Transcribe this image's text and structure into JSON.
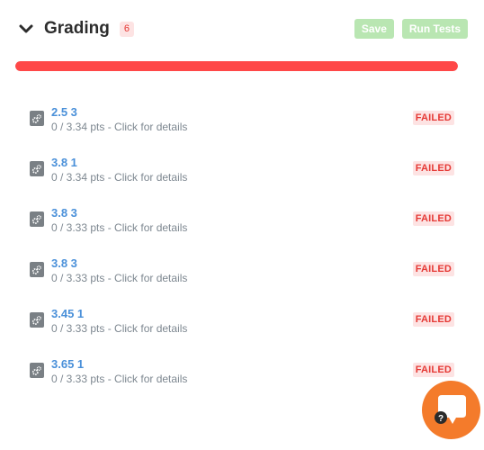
{
  "header": {
    "title": "Grading",
    "count": "6",
    "save_label": "Save",
    "run_tests_label": "Run Tests"
  },
  "progress": {
    "fraction": 1.0,
    "color": "#ff4848"
  },
  "tests": [
    {
      "name": "2.5 3",
      "points": "0 / 3.34 pts - Click for details",
      "status": "FAILED"
    },
    {
      "name": "3.8 1",
      "points": "0 / 3.34 pts - Click for details",
      "status": "FAILED"
    },
    {
      "name": "3.8 3",
      "points": "0 / 3.33 pts - Click for details",
      "status": "FAILED"
    },
    {
      "name": "3.8 3",
      "points": "0 / 3.33 pts - Click for details",
      "status": "FAILED"
    },
    {
      "name": "3.45 1",
      "points": "0 / 3.33 pts - Click for details",
      "status": "FAILED"
    },
    {
      "name": "3.65 1",
      "points": "0 / 3.33 pts - Click for details",
      "status": "FAILED"
    }
  ],
  "chat": {
    "icon": "chat-help-icon",
    "glyph": "?"
  },
  "colors": {
    "accent_fail": "#e53935",
    "link": "#4a90d9",
    "button_disabled": "#b9e6b2",
    "chat": "#f47b2b"
  }
}
